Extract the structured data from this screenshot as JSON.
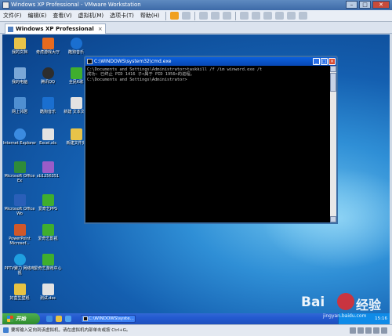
{
  "vmware": {
    "title": "Windows XP Professional - VMware Workstation",
    "menu": [
      "文件(F)",
      "编辑(E)",
      "查看(V)",
      "虚拟机(M)",
      "选项卡(T)",
      "帮助(H)"
    ],
    "tab_label": "Windows XP Professional",
    "status_text": "要将输入定向到该虚拟机，请在虚拟机内部单击或按 Ctrl+G。"
  },
  "desktop_icons": [
    {
      "label": "我的文档",
      "icon": "folder-docs-icon",
      "color": "#e8c349"
    },
    {
      "label": "我的电脑",
      "icon": "computer-icon",
      "color": "#7aa7d8"
    },
    {
      "label": "网上邻居",
      "icon": "network-icon",
      "color": "#4f8fd1"
    },
    {
      "label": "Internet Explorer",
      "icon": "ie-icon",
      "color": "#3b8be0"
    },
    {
      "label": "Microsoft Office Ex",
      "icon": "excel-icon",
      "color": "#2e8b3a"
    },
    {
      "label": "Microsoft Office Wo",
      "icon": "word-icon",
      "color": "#2a5fb8"
    },
    {
      "label": "PowerPoint Microsof...",
      "icon": "powerpoint-icon",
      "color": "#d0582a"
    },
    {
      "label": "PPTV聚力 网络电视",
      "icon": "pptv-icon",
      "color": "#1f9fe0"
    },
    {
      "label": "好盒生壁纸",
      "icon": "wallpaper-icon",
      "color": "#e7c243"
    },
    {
      "label": "奇虎游戏大厅",
      "icon": "game-hall-icon",
      "color": "#e66a1e"
    },
    {
      "label": "腾讯QQ",
      "icon": "qq-icon",
      "color": "#2d2d2d"
    },
    {
      "label": "酷狗音乐",
      "icon": "kugou-icon",
      "color": "#1a6fd0"
    },
    {
      "label": "Excel.xls",
      "icon": "xls-file-icon",
      "color": "#e2e2e2"
    },
    {
      "label": "xb1256351",
      "icon": "file-icon",
      "color": "#9a5cc8"
    },
    {
      "label": "爱奇艺PPS",
      "icon": "iqiyi-icon",
      "color": "#3fae2e"
    },
    {
      "label": "爱奇艺影视",
      "icon": "iqiyi-video-icon",
      "color": "#3fae2e"
    },
    {
      "label": "爱奇艺游戏中心",
      "icon": "iqiyi-game-icon",
      "color": "#3fae2e"
    },
    {
      "label": "测试.doc",
      "icon": "doc-file-icon",
      "color": "#e2e2e2"
    },
    {
      "label": "酷狗音乐",
      "icon": "kugou-icon-2",
      "color": "#1a6fd0"
    },
    {
      "label": "全民K歌",
      "icon": "karaoke-icon",
      "color": "#3fae2e"
    },
    {
      "label": "新建 文本文档",
      "icon": "text-file-icon",
      "color": "#e2e2e2"
    },
    {
      "label": "新建文件夹",
      "icon": "folder-icon",
      "color": "#e8c349"
    }
  ],
  "cmd": {
    "title": "C:\\WINDOWS\\system32\\cmd.exe",
    "lines": [
      "C:\\Documents and Settings\\Administrator>taskkill /f /im winword.exe /t",
      "成功: 已终止 PID 1416 子<属于 PID 1956>的进程。",
      "",
      "C:\\Documents and Settings\\Administrator>"
    ]
  },
  "taskbar": {
    "start_label": "开始",
    "task_label": "C:\\WINDOWS\\syste...",
    "clock": "15:16"
  },
  "watermark": {
    "brand": "Bai",
    "brand_cn": "经验",
    "site": "jingyan.baidu.com"
  }
}
